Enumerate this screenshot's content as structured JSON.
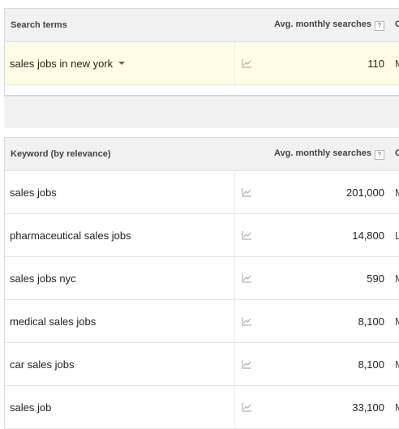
{
  "search_table": {
    "col_term": "Search terms",
    "col_avg": "Avg. monthly searches",
    "col_comp": "C",
    "help_icon": "?",
    "row": {
      "keyword": "sales jobs in new york",
      "avg": "110",
      "comp": "M"
    }
  },
  "keyword_table": {
    "col_keyword": "Keyword (by relevance)",
    "col_avg": "Avg. monthly searches",
    "col_comp": "C",
    "help_icon": "?",
    "rows": [
      {
        "keyword": "sales jobs",
        "avg": "201,000",
        "comp": "M"
      },
      {
        "keyword": "pharmaceutical sales jobs",
        "avg": "14,800",
        "comp": "L"
      },
      {
        "keyword": "sales jobs nyc",
        "avg": "590",
        "comp": "M"
      },
      {
        "keyword": "medical sales jobs",
        "avg": "8,100",
        "comp": "M"
      },
      {
        "keyword": "car sales jobs",
        "avg": "8,100",
        "comp": "M"
      },
      {
        "keyword": "sales job",
        "avg": "33,100",
        "comp": "M"
      }
    ]
  },
  "icons": {
    "trend": "trend-chart-icon",
    "dropdown": "caret-down-icon",
    "help": "help-icon"
  }
}
